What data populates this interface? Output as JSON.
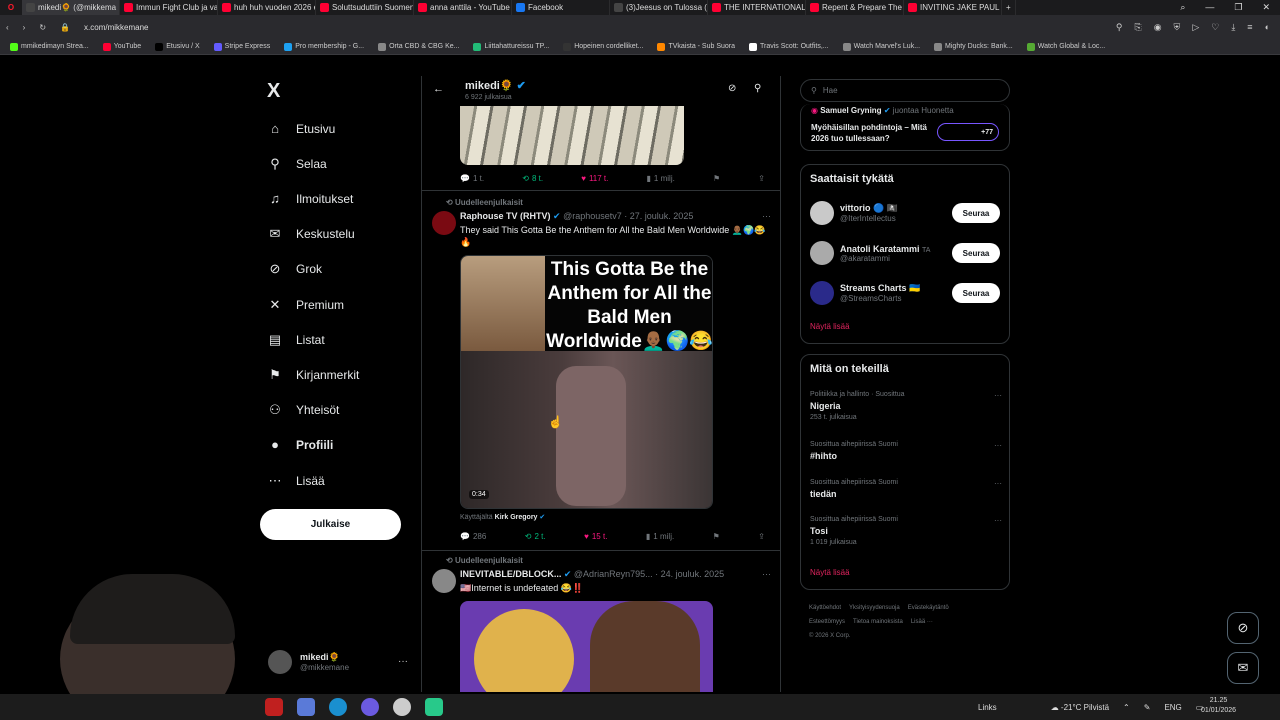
{
  "browser": {
    "tabs": [
      {
        "label": "mikedi🌻 (@mikkema",
        "color": "#444",
        "active": true
      },
      {
        "label": "Immun Fight Club ja vain",
        "color": "#ff0033"
      },
      {
        "label": "huh huh vuoden 2026 ek",
        "color": "#ff0033"
      },
      {
        "label": "Soluttsuduttiin Suomen",
        "color": "#ff0033"
      },
      {
        "label": "anna anttila - YouTube",
        "color": "#ff0033"
      },
      {
        "label": "Facebook",
        "color": "#1877f2"
      },
      {
        "label": "(3)Jeesus on Tulossa (@je",
        "color": "#444"
      },
      {
        "label": "THE INTERNATIONAL CO",
        "color": "#ff0033"
      },
      {
        "label": "Repent & Prepare The Wa",
        "color": "#ff0033"
      },
      {
        "label": "INVITING JAKE PAUL TO T",
        "color": "#ff0033"
      }
    ],
    "url": "x.com/mikkemane",
    "bookmarks": [
      {
        "label": "mmikedimayn Strea...",
        "color": "#53fc18"
      },
      {
        "label": "YouTube",
        "color": "#ff0033"
      },
      {
        "label": "Etusivu / X",
        "color": "#000"
      },
      {
        "label": "Stripe Express",
        "color": "#635bff"
      },
      {
        "label": "Pro membership - G...",
        "color": "#1da1f2"
      },
      {
        "label": "Orta CBD & CBG Ke...",
        "color": "#888"
      },
      {
        "label": "Liittahattureissu TP...",
        "color": "#2b7"
      },
      {
        "label": "Hopeinen cordelliket...",
        "color": "#333"
      },
      {
        "label": "TVkaista - Sub Suora",
        "color": "#f80"
      },
      {
        "label": "Travis Scott: Outfits,...",
        "color": "#fff"
      },
      {
        "label": "Watch Marvel's Luk...",
        "color": "#888"
      },
      {
        "label": "Mighty Ducks: Bank...",
        "color": "#888"
      },
      {
        "label": "Watch Global & Loc...",
        "color": "#5a3"
      }
    ]
  },
  "sidebar": {
    "logo": "X",
    "items": [
      {
        "label": "Etusivu",
        "icon": "home-icon",
        "glyph": "⌂"
      },
      {
        "label": "Selaa",
        "icon": "search-icon",
        "glyph": "⚲"
      },
      {
        "label": "Ilmoitukset",
        "icon": "bell-icon",
        "glyph": "♫"
      },
      {
        "label": "Keskustelu",
        "icon": "mail-icon",
        "glyph": "✉"
      },
      {
        "label": "Grok",
        "icon": "grok-icon",
        "glyph": "⊘"
      },
      {
        "label": "Premium",
        "icon": "x-icon",
        "glyph": "✕"
      },
      {
        "label": "Listat",
        "icon": "list-icon",
        "glyph": "▤"
      },
      {
        "label": "Kirjanmerkit",
        "icon": "bookmark-icon",
        "glyph": "⚑"
      },
      {
        "label": "Yhteisöt",
        "icon": "communities-icon",
        "glyph": "⚇"
      },
      {
        "label": "Profiili",
        "icon": "profile-icon",
        "glyph": "●"
      },
      {
        "label": "Lisää",
        "icon": "more-icon",
        "glyph": "⋯"
      }
    ],
    "post_button": "Julkaise",
    "account": {
      "name": "mikedi🌻",
      "handle": "@mikkemane"
    }
  },
  "profile_header": {
    "name": "mikedi🌻",
    "post_count": "6 922 julkaisua"
  },
  "top_post_actions": {
    "replies": "1 t.",
    "reposts": "8 t.",
    "likes": "117 t.",
    "views": "1 milj."
  },
  "post1": {
    "repost_label": "Uudelleenjulkaisit",
    "author": "Raphouse TV (RHTV)",
    "handle": "@raphousetv7",
    "date": "· 27. jouluk. 2025",
    "text": "They said This Gotta Be the Anthem for All the Bald Men Worldwide 👨🏾‍🦲🌍😂🔥",
    "media_caption": "This Gotta Be the Anthem for All the Bald Men Worldwide👨🏾‍🦲🌍😂",
    "duration": "0:34",
    "via_prefix": "Käyttäjältä",
    "via_user": "Kirk Gregory",
    "replies": "286",
    "reposts": "2 t.",
    "likes": "15 t.",
    "views": "1 milj."
  },
  "post2": {
    "repost_label": "Uudelleenjulkaisit",
    "author": "INEVITABLE/DBLOCK...",
    "handle": "@AdrianReyn795...",
    "date": "· 24. jouluk. 2025",
    "text": "🇺🇸Internet is undefeated 😂‼️"
  },
  "right": {
    "search_placeholder": "Hae",
    "event": {
      "host": "Samuel Gryning",
      "host_suffix": "juontaa Huonetta",
      "title": "Myöhäisillan pohdintoja – Mitä 2026 tuo tullessaan?",
      "listeners": "+77"
    },
    "suggest": {
      "heading": "Saattaisit tykätä",
      "users": [
        {
          "name": "vittorio 🔵 🏴‍☠️",
          "handle": "@IterIntellectus",
          "color": "#c9c9c9"
        },
        {
          "name": "Anatoli Karatammi",
          "suffix": "ΤΑ",
          "handle": "@akaratammi",
          "color": "#aaa"
        },
        {
          "name": "Streams Charts 🇺🇦",
          "handle": "@StreamsCharts",
          "color": "#2a2a8a"
        }
      ],
      "follow_label": "Seuraa",
      "show_more": "Näytä lisää"
    },
    "trends": {
      "heading": "Mitä on tekeillä",
      "items": [
        {
          "context": "Politiikka ja hallinto · Suosittua",
          "name": "Nigeria",
          "count": "253 t. julkaisua"
        },
        {
          "context": "Suosittua aihepiirissä Suomi",
          "name": "#hihto",
          "count": ""
        },
        {
          "context": "Suosittua aihepiirissä Suomi",
          "name": "tiedän",
          "count": ""
        },
        {
          "context": "Suosittua aihepiirissä Suomi",
          "name": "Tosi",
          "count": "1 019 julkaisua"
        }
      ],
      "show_more": "Näytä lisää"
    },
    "footer": [
      "Käyttöehdot",
      "Yksityisyydensuoja",
      "Evästekäytäntö",
      "Esteettömyys",
      "Tietoa mainoksista",
      "Lisää ···",
      "© 2026 X Corp."
    ]
  },
  "taskbar": {
    "links": "Links",
    "weather": "-21°C Pilvistä",
    "lang": "ENG",
    "time": "21.25",
    "date": "01/01/2026"
  },
  "colors": {
    "like": "#f91880",
    "repost": "#00ba7c",
    "verified": "#1d9bf0",
    "accent_link": "#e0245e"
  }
}
